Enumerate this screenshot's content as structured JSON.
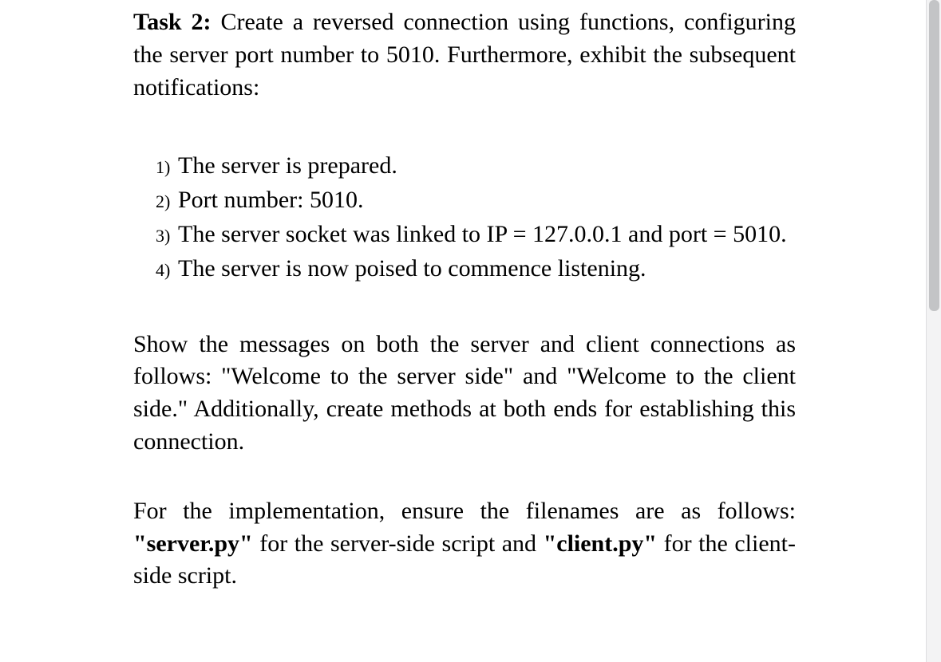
{
  "task": {
    "label": "Task 2:",
    "intro": " Create a reversed connection using functions, configuring the server port number to 5010. Furthermore, exhibit the subsequent notifications:"
  },
  "list": {
    "items": [
      {
        "marker": "1)",
        "text": "The server is prepared."
      },
      {
        "marker": "2)",
        "text": "Port number: 5010."
      },
      {
        "marker": "3)",
        "text": "The server socket was linked to IP = 127.0.0.1 and port = 5010."
      },
      {
        "marker": "4)",
        "text": "The server is now poised to commence listening."
      }
    ]
  },
  "para1": "Show the messages on both the server and client connections as follows: \"Welcome to the server side\" and \"Welcome to the client side.\" Additionally, create methods at both ends for establishing this connection.",
  "para2": {
    "pre": "For the implementation, ensure the filenames are as follows: ",
    "file1": "\"server.py\"",
    "mid": " for the server-side script and ",
    "file2": "\"client.py\"",
    "post": " for the client-side script."
  }
}
